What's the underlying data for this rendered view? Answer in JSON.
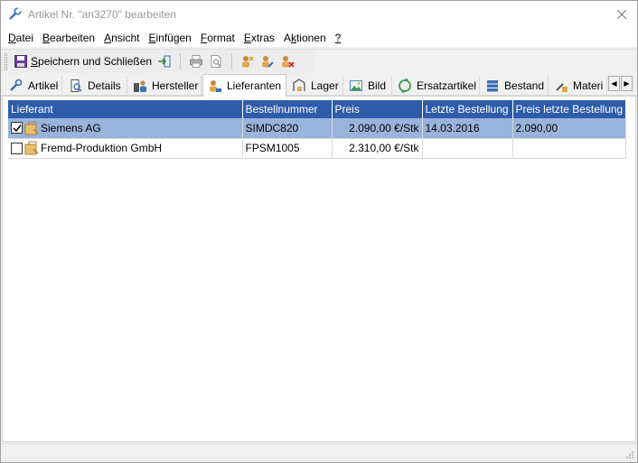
{
  "window": {
    "title": "Artikel Nr. \"an3270\" bearbeiten"
  },
  "menu": [
    {
      "accel": "D",
      "rest": "atei"
    },
    {
      "accel": "B",
      "rest": "earbeiten"
    },
    {
      "accel": "A",
      "rest": "nsicht"
    },
    {
      "accel": "E",
      "rest": "infügen"
    },
    {
      "accel": "F",
      "rest": "ormat"
    },
    {
      "accel": "E",
      "rest": "xtras"
    },
    {
      "pre": "A",
      "accel": "k",
      "rest": "tionen"
    },
    {
      "accel": "?",
      "rest": ""
    }
  ],
  "toolbar": {
    "save_close_accel": "S",
    "save_close_rest": "peichern und Schließen"
  },
  "tabs": [
    {
      "label": "Artikel"
    },
    {
      "label": "Details"
    },
    {
      "label": "Hersteller"
    },
    {
      "label": "Lieferanten"
    },
    {
      "label": "Lager"
    },
    {
      "label": "Bild"
    },
    {
      "label": "Ersatzartikel"
    },
    {
      "label": "Bestand"
    },
    {
      "label": "Materi"
    }
  ],
  "grid": {
    "columns": [
      "Lieferant",
      "Bestellnummer",
      "Preis",
      "Letzte Bestellung",
      "Preis letzte Bestellung"
    ],
    "rows": [
      {
        "checked": true,
        "lieferant": "Siemens AG",
        "bestellnummer": "SIMDC820",
        "preis": "2.090,00 €/Stk",
        "letzte_bestellung": "14.03.2016",
        "preis_letzte": "2.090,00"
      },
      {
        "checked": false,
        "lieferant": "Fremd-Produktion GmbH",
        "bestellnummer": "FPSM1005",
        "preis": "2.310,00 €/Stk",
        "letzte_bestellung": "",
        "preis_letzte": ""
      }
    ]
  },
  "colors": {
    "header_bg": "#2e5cab",
    "selected_row": "#99b4dc"
  }
}
